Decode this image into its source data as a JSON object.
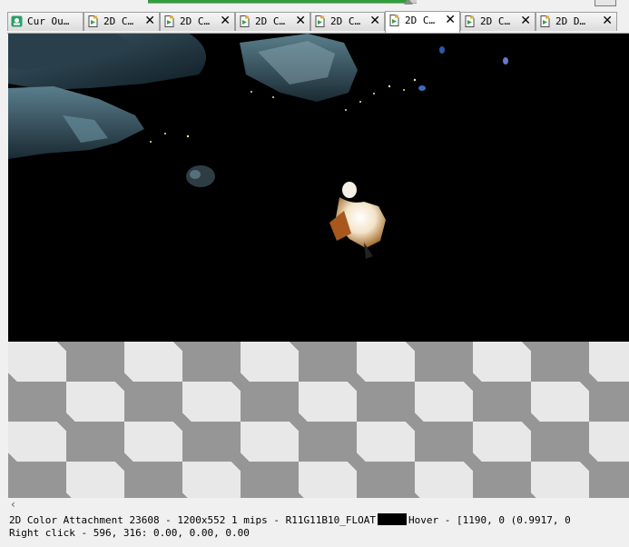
{
  "tabs": [
    {
      "label": "Cur Ou…",
      "icon": "camera-icon",
      "closable": false,
      "active": false
    },
    {
      "label": "2D C…",
      "icon": "document-icon",
      "closable": true,
      "active": false
    },
    {
      "label": "2D C…",
      "icon": "document-icon",
      "closable": true,
      "active": false
    },
    {
      "label": "2D C…",
      "icon": "document-icon",
      "closable": true,
      "active": false
    },
    {
      "label": "2D C…",
      "icon": "document-icon",
      "closable": true,
      "active": false
    },
    {
      "label": "2D C…",
      "icon": "document-icon",
      "closable": true,
      "active": true
    },
    {
      "label": "2D C…",
      "icon": "document-icon",
      "closable": true,
      "active": false
    },
    {
      "label": "2D D…",
      "icon": "document-icon",
      "closable": true,
      "active": false
    }
  ],
  "close_glyph": "✕",
  "progress": {
    "fraction": 0.97
  },
  "status": {
    "line1_prefix": "2D Color Attachment 23608 - 1200x552 1 mips - R11G11B10_FLOAT",
    "line1_suffix": "Hover - [1190,    0 (0.9917, 0",
    "line2": "Right click -  596,  316: 0.00, 0.00, 0.00",
    "swatch_color": "#000000"
  },
  "scroll_left_glyph": "‹",
  "colors": {
    "accent_green": "#2f9e3a",
    "checker_dark": "#969696",
    "checker_light": "#e8e8e8"
  }
}
